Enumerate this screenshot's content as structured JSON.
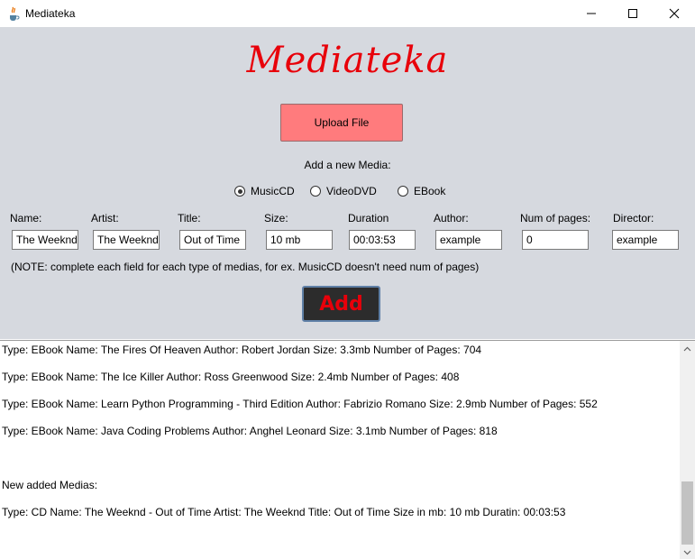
{
  "window": {
    "title": "Mediateka",
    "icon": "java-icon",
    "controls": [
      "minimize-icon",
      "maximize-icon",
      "close-icon"
    ]
  },
  "header": {
    "logo_text": "Mediateka"
  },
  "upload_button": {
    "label": "Upload File"
  },
  "add_media": {
    "label": "Add a new Media:",
    "types": [
      {
        "label": "MusicCD",
        "selected": true
      },
      {
        "label": "VideoDVD",
        "selected": false
      },
      {
        "label": "EBook",
        "selected": false
      }
    ]
  },
  "fields": [
    {
      "label": "Name:",
      "value": "The Weeknd"
    },
    {
      "label": "Artist:",
      "value": "The Weeknd"
    },
    {
      "label": "Title:",
      "value": "Out of Time"
    },
    {
      "label": "Size:",
      "value": "10 mb"
    },
    {
      "label": "Duration",
      "value": "00:03:53"
    },
    {
      "label": "Author:",
      "value": "example"
    },
    {
      "label": "Num of pages:",
      "value": "0"
    },
    {
      "label": "Director:",
      "value": "example"
    }
  ],
  "note": "(NOTE: complete each field for each type of medias, for ex. MusicCD doesn't need num of pages)",
  "add_button": {
    "label": "Add"
  },
  "output_lines": [
    "Type: EBook Name: The Fires Of Heaven Author: Robert Jordan Size: 3.3mb Number of Pages: 704",
    "Type: EBook Name: The Ice Killer Author: Ross Greenwood Size: 2.4mb Number of Pages: 408",
    "Type: EBook Name: Learn Python Programming - Third Edition Author: Fabrizio Romano Size: 2.9mb Number of Pages: 552",
    "Type: EBook Name: Java Coding Problems Author: Anghel Leonard Size: 3.1mb Number of Pages: 818",
    "",
    "New added Medias:",
    "Type: CD Name: The Weeknd - Out of Time Artist: The Weeknd  Title: Out of Time  Size in mb: 10 mb Duratin: 00:03:53"
  ],
  "colors": {
    "panel_background": "#d6d9df",
    "logo": "#e8000a",
    "upload_button": "#ff7b7d",
    "add_button_bg": "#2c2c2c",
    "add_button_text": "#e8000a"
  }
}
